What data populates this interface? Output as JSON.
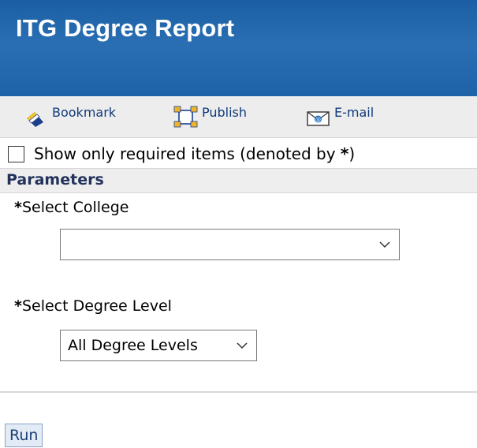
{
  "header": {
    "title": "ITG Degree Report",
    "background_color": "#1e62a7"
  },
  "toolbar": {
    "bookmark_label": "Bookmark",
    "publish_label": "Publish",
    "email_label": "E-mail",
    "bookmark_icon": "bookmark-icon",
    "publish_icon": "publish-icon",
    "email_icon": "email-icon"
  },
  "required_toggle": {
    "label_prefix": "Show only required items (denoted by ",
    "asterisk": "*",
    "label_suffix": ")",
    "checked": false
  },
  "parameters": {
    "section_label": "Parameters",
    "fields": [
      {
        "required_marker": "*",
        "label": "Select College",
        "value": ""
      },
      {
        "required_marker": "*",
        "label": "Select Degree Level",
        "value": "All Degree Levels"
      }
    ]
  },
  "actions": {
    "run_label": "Run"
  }
}
